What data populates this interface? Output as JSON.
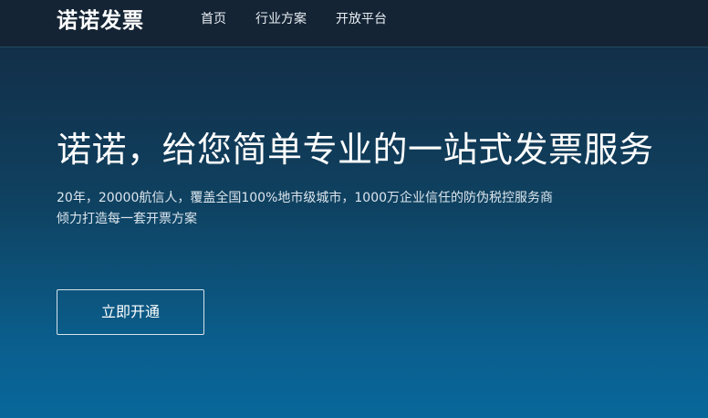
{
  "header": {
    "logo_text": "诺诺发票",
    "nav": [
      {
        "label": "首页"
      },
      {
        "label": "行业方案"
      },
      {
        "label": "开放平台"
      }
    ]
  },
  "hero": {
    "title": "诺诺，给您简单专业的一站式发票服务",
    "description_line1": "20年，20000航信人，覆盖全国100%地市级城市，1000万企业信任的防伪税控服务商",
    "description_line2": "倾力打造每一套开票方案",
    "cta_label": "立即开通"
  }
}
